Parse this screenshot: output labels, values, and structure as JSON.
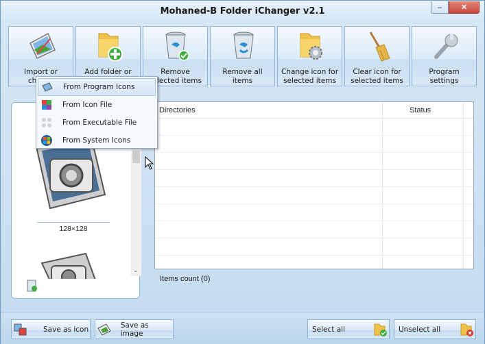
{
  "window": {
    "title": "Mohaned-B Folder iChanger v2.1",
    "minimize": "–",
    "close": "✕"
  },
  "toolbar": [
    {
      "id": "import",
      "label": "Import or choose",
      "icon": "picture-frame-icon"
    },
    {
      "id": "add-folder",
      "label": "Add folder or",
      "icon": "folder-add-icon"
    },
    {
      "id": "remove",
      "label": "Remove selected items",
      "icon": "recycle-bin-check-icon"
    },
    {
      "id": "remove-all",
      "label": "Remove all items",
      "icon": "recycle-bin-icon"
    },
    {
      "id": "change-icon",
      "label": "Change icon for selected items",
      "icon": "folder-gear-icon"
    },
    {
      "id": "clear-icon",
      "label": "Clear icon for selected items",
      "icon": "broom-icon"
    },
    {
      "id": "settings",
      "label": "Program settings",
      "icon": "wrench-icon"
    }
  ],
  "context_menu": [
    {
      "label": "From Program Icons",
      "icon": "program-icons-icon",
      "highlighted": true
    },
    {
      "label": "From Icon File",
      "icon": "icon-file-icon",
      "highlighted": false
    },
    {
      "label": "From Executable File",
      "icon": "executable-file-icon",
      "highlighted": false
    },
    {
      "label": "From System Icons",
      "icon": "system-icons-icon",
      "highlighted": false
    }
  ],
  "preview": {
    "size_label": "128×128",
    "scroll_arrow": "⌄"
  },
  "table": {
    "columns": [
      "Directories",
      "Status"
    ],
    "rows": []
  },
  "status": {
    "items_count": "Items count (0)"
  },
  "bottom": {
    "save_icon": "Save as icon",
    "save_image": "Save as image",
    "select_all": "Select all",
    "unselect_all": "Unselect all"
  }
}
